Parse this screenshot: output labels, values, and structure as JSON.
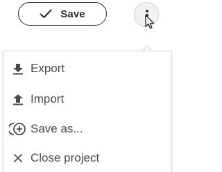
{
  "toolbar": {
    "save_label": "Save",
    "save_icon": "check-icon",
    "more_icon": "vertical-dots-icon"
  },
  "menu": {
    "items": [
      {
        "label": "Export",
        "icon": "download-icon"
      },
      {
        "label": "Import",
        "icon": "upload-icon"
      },
      {
        "label": "Save as...",
        "icon": "add-circle-icon"
      },
      {
        "label": "Close project",
        "icon": "close-icon"
      }
    ]
  },
  "colors": {
    "text": "#4a4a4a",
    "border": "#2a2a2a",
    "menu_border": "#d6d6d6",
    "more_bg": "#f1f1f1"
  }
}
